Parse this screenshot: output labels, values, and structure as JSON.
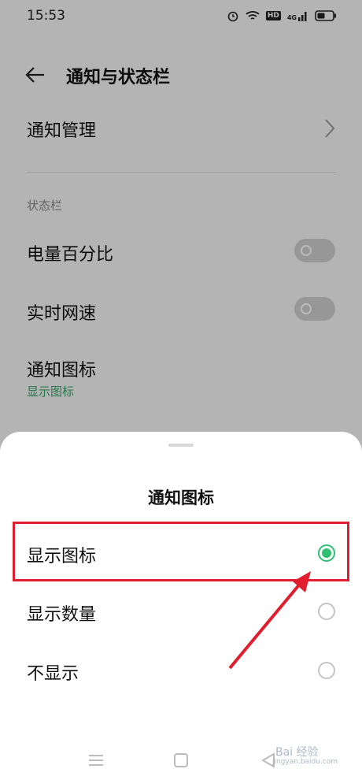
{
  "status_bar": {
    "time": "15:53",
    "icons": [
      "alarm-icon",
      "wifi-icon",
      "hd-icon",
      "signal-4g-icon",
      "battery-icon"
    ],
    "hd_label": "HD",
    "network_label": "4G"
  },
  "app_bar": {
    "title": "通知与状态栏",
    "back_icon": "arrow-left-icon"
  },
  "settings": {
    "notification_management": "通知管理",
    "statusbar_section": "状态栏",
    "battery_percentage": "电量百分比",
    "battery_percentage_enabled": false,
    "realtime_speed": "实时网速",
    "realtime_speed_enabled": false,
    "notification_icon": "通知图标",
    "notification_icon_value": "显示图标"
  },
  "sheet": {
    "title": "通知图标",
    "options": [
      {
        "label": "显示图标",
        "selected": true
      },
      {
        "label": "显示数量",
        "selected": false
      },
      {
        "label": "不显示",
        "selected": false
      }
    ]
  },
  "nav_bar": {
    "icons": [
      "menu-icon",
      "home-icon",
      "back-triangle-icon"
    ]
  },
  "watermark": {
    "text": "Bai 经验",
    "sub": "jingyan.baidu.com"
  },
  "colors": {
    "accent": "#2fbf71",
    "highlight": "#e01e2e",
    "subtext_green": "#36a36b"
  }
}
